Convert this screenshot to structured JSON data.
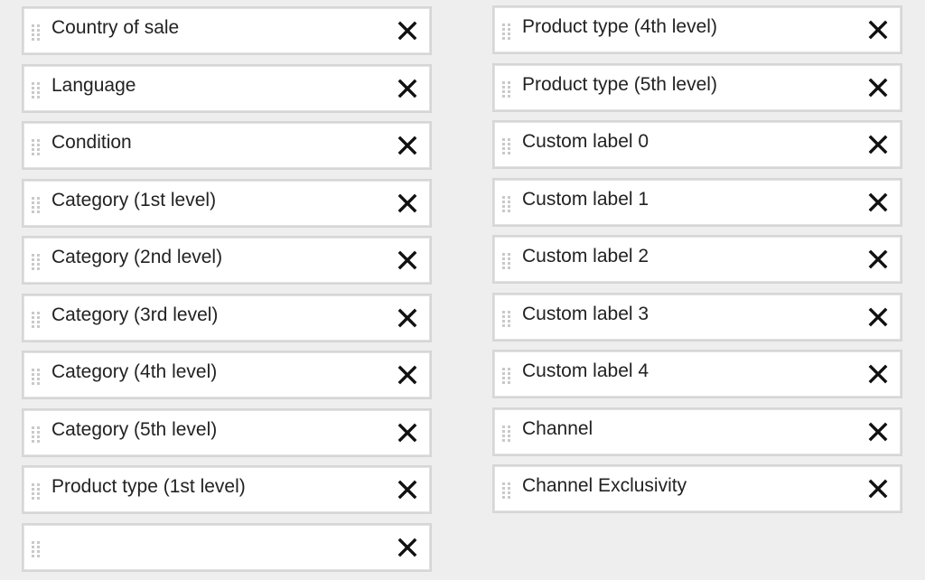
{
  "columns": {
    "left": [
      {
        "label": "Country of sale"
      },
      {
        "label": "Language"
      },
      {
        "label": "Condition"
      },
      {
        "label": "Category (1st level)"
      },
      {
        "label": "Category (2nd level)"
      },
      {
        "label": "Category (3rd level)"
      },
      {
        "label": "Category (4th level)"
      },
      {
        "label": "Category (5th level)"
      },
      {
        "label": "Product type (1st level)"
      },
      {
        "label": ""
      }
    ],
    "right": [
      {
        "label": "Product type (4th level)"
      },
      {
        "label": "Product type (5th level)"
      },
      {
        "label": "Custom label 0"
      },
      {
        "label": "Custom label 1"
      },
      {
        "label": "Custom label 2"
      },
      {
        "label": "Custom label 3"
      },
      {
        "label": "Custom label 4"
      },
      {
        "label": "Channel"
      },
      {
        "label": "Channel Exclusivity"
      }
    ]
  },
  "icons": {
    "drag_handle": "drag-handle-icon",
    "remove": "close-icon"
  },
  "colors": {
    "background": "#eeeeee",
    "chip_background": "#ffffff",
    "chip_border": "#d6d6d6",
    "grip": "#c9c9c9",
    "text": "#222222",
    "remove_icon": "#111111"
  }
}
